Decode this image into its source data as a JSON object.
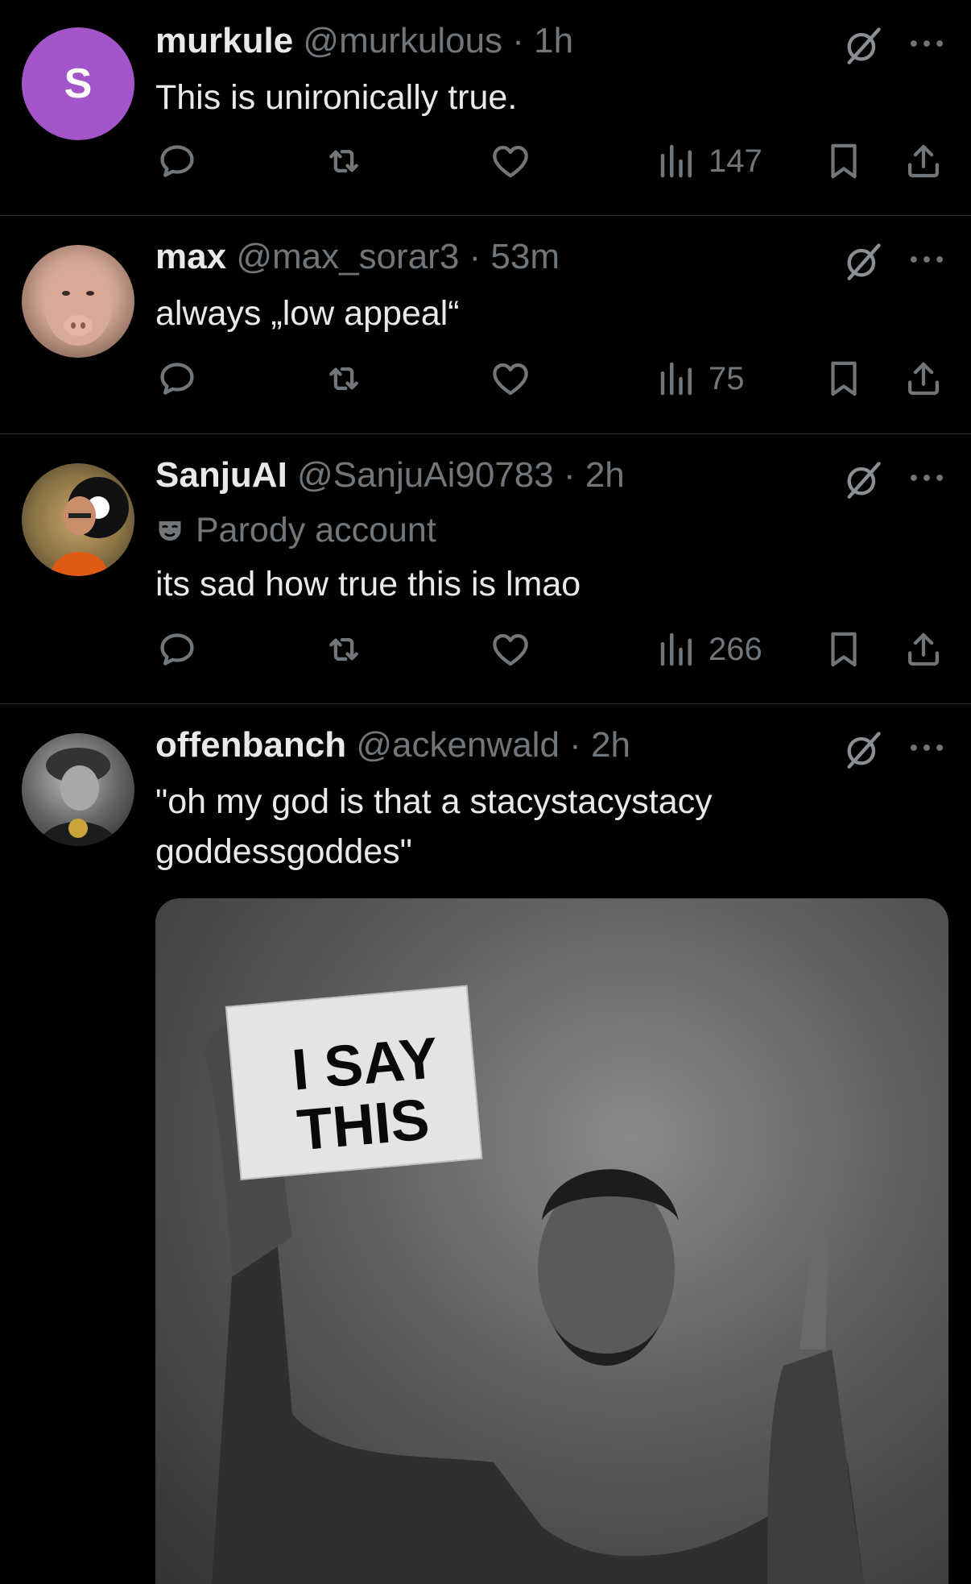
{
  "tweets": [
    {
      "avatar_letter": "S",
      "display_name": "murkule",
      "handle": "@murkulous",
      "time": "1h",
      "text": "This is unironically true.",
      "views": "147"
    },
    {
      "display_name": "max",
      "handle": "@max_sorar3",
      "time": "53m",
      "text": "always „low appeal“",
      "views": "75"
    },
    {
      "display_name": "SanjuAI",
      "handle": "@SanjuAi90783",
      "time": "2h",
      "badge": "Parody account",
      "text": "its sad how true this is lmao",
      "views": "266"
    },
    {
      "display_name": "offenbanch",
      "handle": "@ackenwald",
      "time": "2h",
      "text_line1": "\"oh my god is that a stacystacystacy",
      "text_line2": "goddessgoddes\"",
      "image_sign": [
        "I SAY",
        "THIS"
      ]
    }
  ],
  "separator": " · ",
  "colors": {
    "background": "#000000",
    "text": "#e7e9ea",
    "muted": "#71767b",
    "divider": "#2f3336",
    "avatar_purple": "#a356c9"
  }
}
